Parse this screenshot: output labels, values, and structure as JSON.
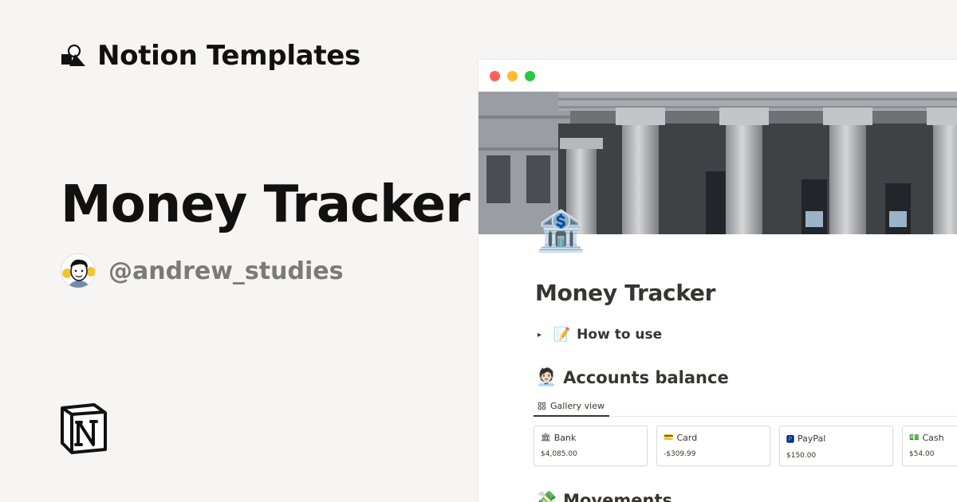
{
  "brand": {
    "name": "Notion Templates",
    "logo_icon": "notion-templates-shapes-icon"
  },
  "hero": {
    "title": "Money Tracker"
  },
  "author": {
    "handle": "@andrew_studies",
    "avatar_icon": "avatar-illustration"
  },
  "notion_logo": "notion-n-logo-icon",
  "window": {
    "controls": [
      "close",
      "minimize",
      "maximize"
    ],
    "page": {
      "icon": "🏦",
      "title": "Money Tracker",
      "toggle": {
        "arrow": "▸",
        "emoji": "📝",
        "label": "How to use"
      },
      "accounts": {
        "emoji": "🧑🏻‍💼",
        "heading": "Accounts balance",
        "view_label": "Gallery view",
        "cards": [
          {
            "emoji": "🏛",
            "name": "Bank",
            "value": "$4,085.00"
          },
          {
            "emoji": "💳",
            "name": "Card",
            "value": "-$309.99"
          },
          {
            "emoji": "🅿",
            "name": "PayPal",
            "value": "$150.00"
          },
          {
            "emoji": "💵",
            "name": "Cash",
            "value": "$54.00"
          }
        ]
      },
      "movements": {
        "emoji": "💸",
        "heading": "Movements"
      }
    }
  },
  "colors": {
    "background": "#f6f5f3",
    "text": "#111111",
    "muted": "#7a7a7a",
    "notion_text": "#37352f",
    "traffic_red": "#ff5f57",
    "traffic_yellow": "#febc2e",
    "traffic_green": "#28c840"
  }
}
